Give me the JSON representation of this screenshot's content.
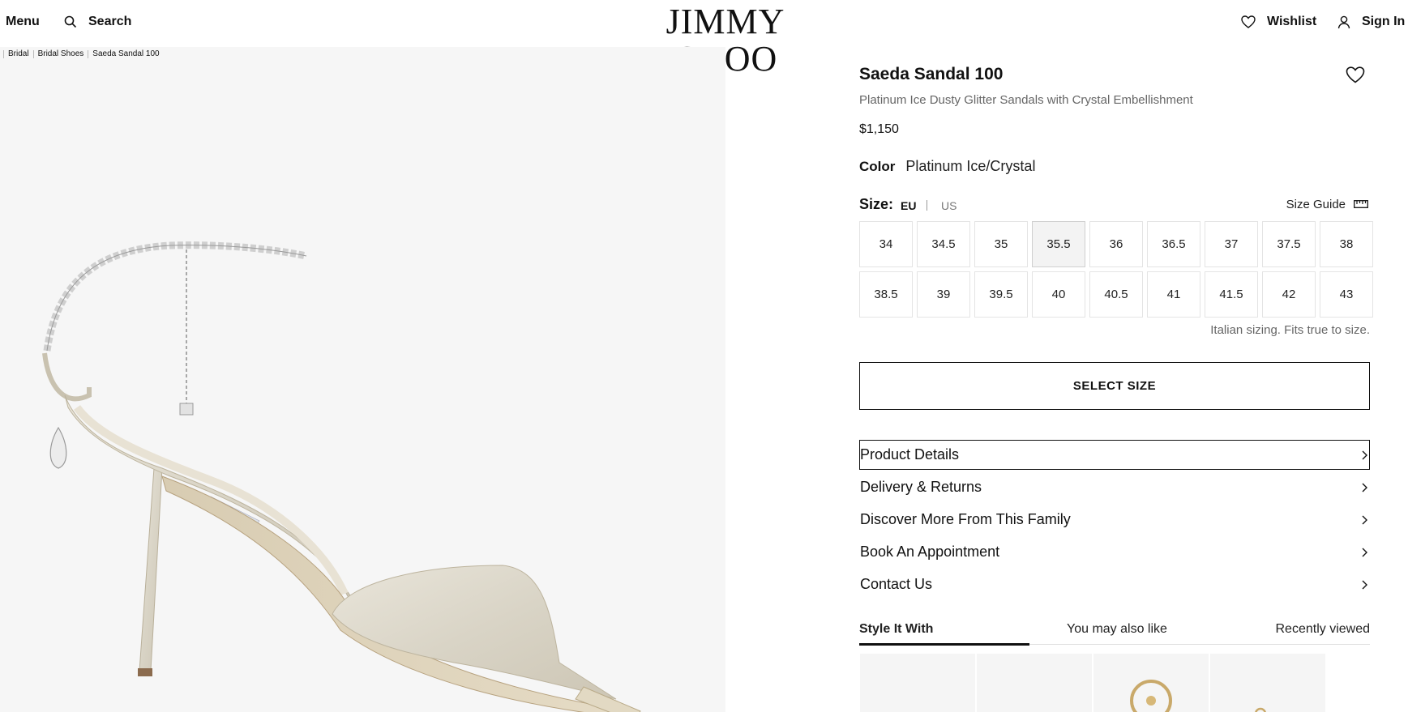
{
  "header": {
    "menu_label": "Menu",
    "search_label": "Search",
    "logo_text": "JIMMY CHOO",
    "wishlist_label": "Wishlist",
    "signin_label": "Sign In"
  },
  "breadcrumb": [
    "Bridal",
    "Bridal Shoes",
    "Saeda Sandal 100"
  ],
  "product": {
    "name": "Saeda Sandal 100",
    "subtitle": "Platinum Ice Dusty Glitter Sandals with Crystal Embellishment",
    "price": "$1,150",
    "color_label": "Color",
    "color_value": "Platinum Ice/Crystal"
  },
  "size": {
    "label": "Size:",
    "eu_label": "EU",
    "us_label": "US",
    "guide_label": "Size Guide",
    "options": [
      "34",
      "34.5",
      "35",
      "35.5",
      "36",
      "36.5",
      "37",
      "37.5",
      "38",
      "38.5",
      "39",
      "39.5",
      "40",
      "40.5",
      "41",
      "41.5",
      "42",
      "43"
    ],
    "selected": "35.5",
    "note": "Italian sizing. Fits true to size."
  },
  "select_button_label": "SELECT SIZE",
  "accordion": [
    "Product Details",
    "Delivery & Returns",
    "Discover More From This Family",
    "Book An Appointment",
    "Contact Us"
  ],
  "tabs": [
    "Style It With",
    "You may also like",
    "Recently viewed"
  ],
  "active_tab": "Style It With"
}
